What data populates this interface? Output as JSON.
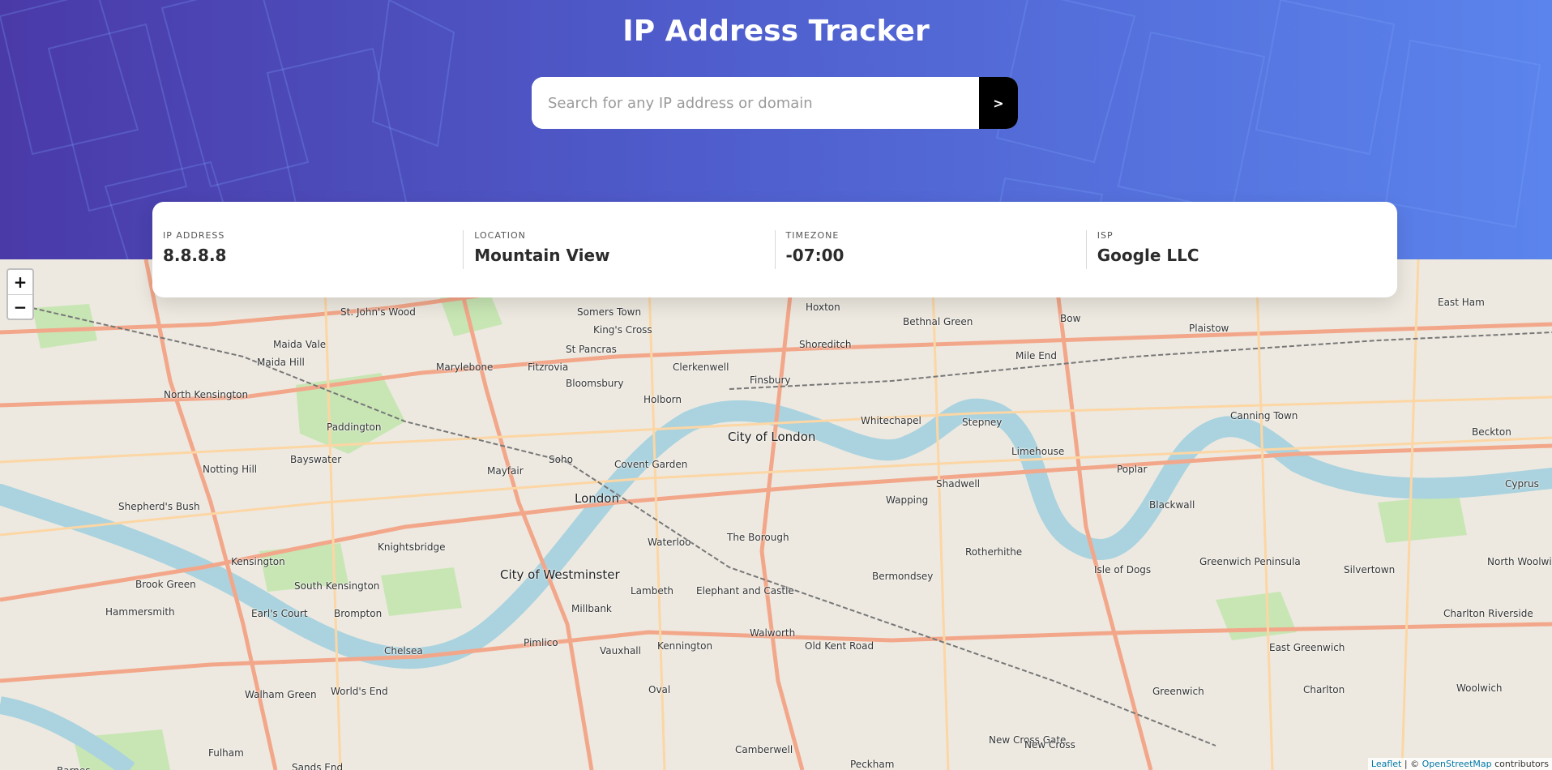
{
  "header": {
    "title": "IP Address Tracker",
    "search_placeholder": "Search for any IP address or domain",
    "submit_label": ">"
  },
  "info": {
    "ip_label": "IP ADDRESS",
    "ip_value": "8.8.8.8",
    "location_label": "LOCATION",
    "location_value": "Mountain View",
    "timezone_label": "TIMEZONE",
    "timezone_value": "-07:00",
    "isp_label": "ISP",
    "isp_value": "Google LLC"
  },
  "map": {
    "zoom_in": "+",
    "zoom_out": "−",
    "places": [
      "St. John's Wood",
      "Somers Town",
      "Hoxton",
      "Bethnal Green",
      "Bow",
      "Plaistow",
      "East Ham",
      "Maida Vale",
      "King's Cross",
      "Shoreditch",
      "Maida Hill",
      "St Pancras",
      "Marylebone",
      "Fitzrovia",
      "Clerkenwell",
      "Finsbury",
      "Mile End",
      "North Kensington",
      "Bloomsbury",
      "Holborn",
      "Paddington",
      "City of London",
      "Whitechapel",
      "Stepney",
      "Canning Town",
      "Beckton",
      "Bayswater",
      "Soho",
      "Limehouse",
      "Notting Hill",
      "Mayfair",
      "Covent Garden",
      "Poplar",
      "Shadwell",
      "Shepherd's Bush",
      "London",
      "Wapping",
      "Blackwall",
      "Cyprus",
      "Waterloo",
      "The Borough",
      "Knightsbridge",
      "Rotherhithe",
      "Greenwich Peninsula",
      "Silvertown",
      "North Woolwich",
      "Kensington",
      "City of Westminster",
      "Bermondsey",
      "Isle of Dogs",
      "Brook Green",
      "South Kensington",
      "Lambeth",
      "Elephant and Castle",
      "Hammersmith",
      "Earl's Court",
      "Brompton",
      "Millbank",
      "Charlton Riverside",
      "Chelsea",
      "Pimlico",
      "Vauxhall",
      "Kennington",
      "Walworth",
      "Old Kent Road",
      "East Greenwich",
      "World's End",
      "Walham Green",
      "Oval",
      "Greenwich",
      "Charlton",
      "Woolwich",
      "Fulham",
      "Camberwell",
      "New Cross Gate",
      "New Cross",
      "Peckham",
      "Sands End",
      "Barnes"
    ],
    "attribution_leaflet": "Leaflet",
    "attribution_sep": " | © ",
    "attribution_osm": "OpenStreetMap",
    "attribution_tail": " contributors"
  }
}
